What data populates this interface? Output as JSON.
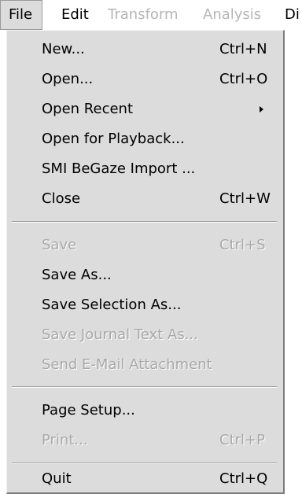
{
  "menubar": {
    "items": [
      {
        "label": "File",
        "state": "active"
      },
      {
        "label": "Edit",
        "state": "enabled"
      },
      {
        "label": "Transform",
        "state": "disabled"
      },
      {
        "label": "Analysis",
        "state": "disabled"
      },
      {
        "label": "Di",
        "state": "enabled"
      }
    ]
  },
  "file_menu": {
    "items": [
      {
        "label": "New...",
        "shortcut": "Ctrl+N",
        "enabled": true
      },
      {
        "label": "Open...",
        "shortcut": "Ctrl+O",
        "enabled": true
      },
      {
        "label": "Open Recent",
        "shortcut": "",
        "enabled": true,
        "submenu_icon": "triangle-right-icon"
      },
      {
        "label": "Open for Playback...",
        "shortcut": "",
        "enabled": true
      },
      {
        "label": "SMI BeGaze Import ...",
        "shortcut": "",
        "enabled": true
      },
      {
        "label": "Close",
        "shortcut": "Ctrl+W",
        "enabled": true
      },
      {
        "label": "Save",
        "shortcut": "Ctrl+S",
        "enabled": false
      },
      {
        "label": "Save As...",
        "shortcut": "",
        "enabled": true
      },
      {
        "label": "Save Selection As...",
        "shortcut": "",
        "enabled": true
      },
      {
        "label": "Save Journal Text As...",
        "shortcut": "",
        "enabled": false
      },
      {
        "label": "Send E-Mail Attachment",
        "shortcut": "",
        "enabled": false
      },
      {
        "label": "Page Setup...",
        "shortcut": "",
        "enabled": true
      },
      {
        "label": "Print...",
        "shortcut": "Ctrl+P",
        "enabled": false
      },
      {
        "label": "Quit",
        "shortcut": "Ctrl+Q",
        "enabled": true
      }
    ]
  },
  "colors": {
    "menu_background": "#dcdcdc",
    "disabled_text": "#a8a8a8",
    "enabled_text": "#000000"
  }
}
